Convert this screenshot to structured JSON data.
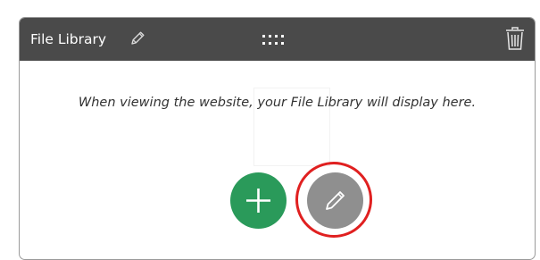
{
  "widget": {
    "title": "File Library",
    "placeholder": "When viewing the website, your File Library will display here."
  },
  "icons": {
    "title_edit": "pencil-icon",
    "drag_handle": "drag-handle-icon",
    "delete": "trash-icon",
    "add": "plus-icon",
    "edit": "pencil-icon"
  },
  "colors": {
    "header_bg": "#4a4a4a",
    "add_button": "#2a9a5a",
    "edit_button": "#8f8f8f",
    "highlight": "#e02020"
  }
}
